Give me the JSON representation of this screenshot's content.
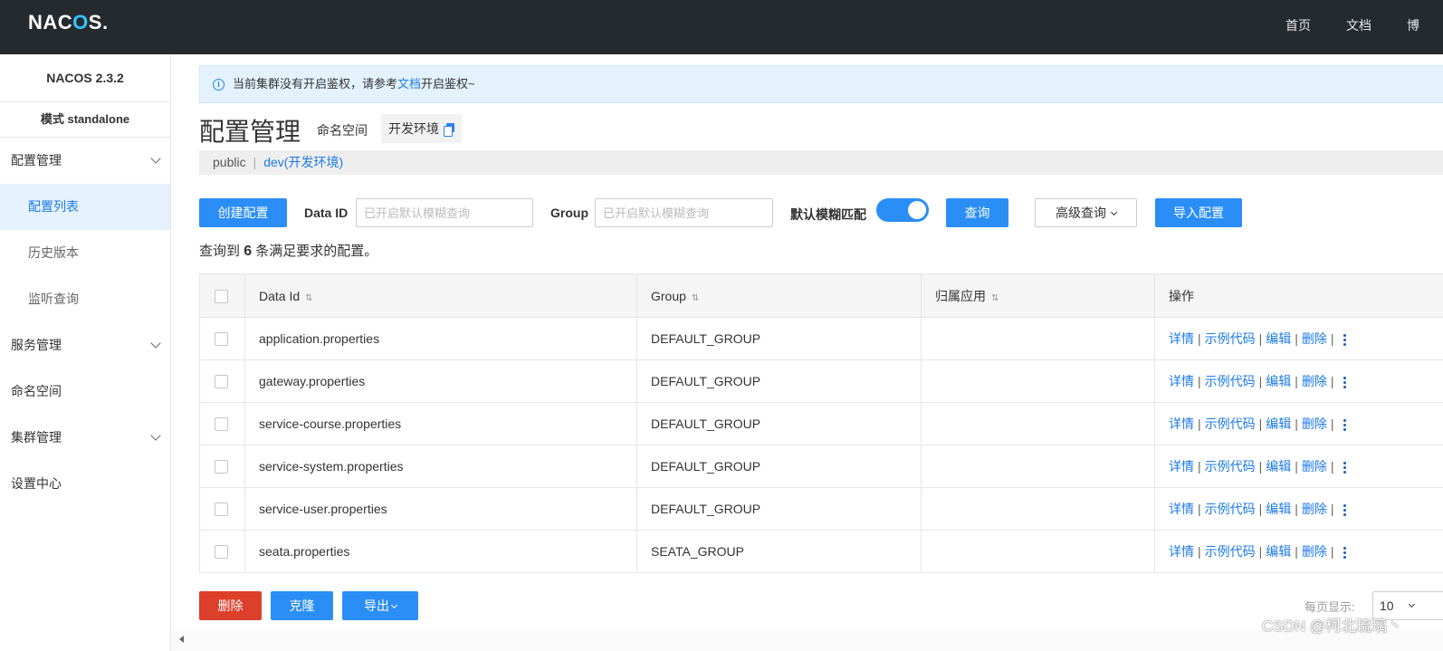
{
  "topbar": {
    "logo": {
      "pre": "NAC",
      "accent": "O",
      "post": "S."
    },
    "nav": [
      "首页",
      "文档",
      "博"
    ]
  },
  "sidebar": {
    "version": "NACOS 2.3.2",
    "mode": "模式 standalone",
    "items": [
      {
        "label": "配置管理",
        "expandable": true
      },
      {
        "label": "配置列表",
        "sub": true,
        "active": true
      },
      {
        "label": "历史版本",
        "sub": true
      },
      {
        "label": "监听查询",
        "sub": true
      },
      {
        "label": "服务管理",
        "expandable": true
      },
      {
        "label": "命名空间"
      },
      {
        "label": "集群管理",
        "expandable": true
      },
      {
        "label": "设置中心"
      }
    ]
  },
  "notice": {
    "before": "当前集群没有开启鉴权，请参考",
    "link": "文档",
    "after": "开启鉴权~"
  },
  "header": {
    "title": "配置管理",
    "namespace_label": "命名空间",
    "namespace_value": "开发环境"
  },
  "namespaces": {
    "public": "public",
    "separator": "|",
    "current": "dev(开发环境)"
  },
  "search": {
    "create_button": "创建配置",
    "data_id_label": "Data ID",
    "data_id_placeholder": "已开启默认模糊查询",
    "group_label": "Group",
    "group_placeholder": "已开启默认模糊查询",
    "fuzzy_label": "默认模糊匹配",
    "query_button": "查询",
    "advanced_button": "高级查询",
    "import_button": "导入配置"
  },
  "result": {
    "prefix": "查询到",
    "count": "6",
    "suffix": "条满足要求的配置。"
  },
  "table": {
    "columns": [
      "Data Id",
      "Group",
      "归属应用",
      "操作"
    ],
    "rows": [
      {
        "data_id": "application.properties",
        "group": "DEFAULT_GROUP",
        "app": ""
      },
      {
        "data_id": "gateway.properties",
        "group": "DEFAULT_GROUP",
        "app": ""
      },
      {
        "data_id": "service-course.properties",
        "group": "DEFAULT_GROUP",
        "app": ""
      },
      {
        "data_id": "service-system.properties",
        "group": "DEFAULT_GROUP",
        "app": ""
      },
      {
        "data_id": "service-user.properties",
        "group": "DEFAULT_GROUP",
        "app": ""
      },
      {
        "data_id": "seata.properties",
        "group": "SEATA_GROUP",
        "app": ""
      }
    ],
    "ops": {
      "detail": "详情",
      "sample": "示例代码",
      "edit": "编辑",
      "delete": "删除",
      "sep": "|"
    }
  },
  "footer": {
    "delete_button": "删除",
    "clone_button": "克隆",
    "export_button": "导出",
    "page_size_label": "每页显示:",
    "page_size": "10"
  },
  "watermark": "CSDN @柯北琉璃丶",
  "colors": {
    "topbar": "#252a2f",
    "primary": "#2a8ef6",
    "danger": "#dc3f2a",
    "link": "#1b7ae8",
    "logo_accent": "#32c5ff"
  }
}
